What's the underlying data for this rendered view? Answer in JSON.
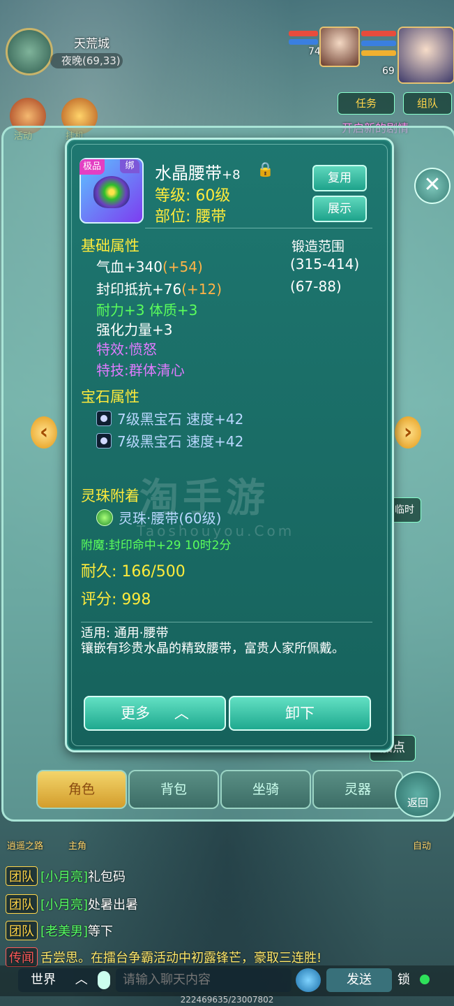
{
  "hud": {
    "city": "天荒城",
    "coord": "夜晚(69,33)",
    "pet_level": "74",
    "player_level": "69",
    "task_btn": "任务",
    "team_btn": "组队",
    "quest_hint": "开启新的剧情",
    "activity_label": "活动",
    "hangup_label": "挂机",
    "side_left_label": "逍遥之路",
    "side_char_label": "主角",
    "auto_label": "自动"
  },
  "tooltip": {
    "quality_badge": "极品",
    "bind_badge": "绑",
    "item_name": "水晶腰带",
    "item_plus": "+8",
    "level_line": "等级: 60级",
    "slot_line": "部位: 腰带",
    "btn_reuse": "复用",
    "btn_show": "展示",
    "base_title": "基础属性",
    "forge_title": "锻造范围",
    "attrs": [
      {
        "text": "气血+340",
        "bonus": "(+54)",
        "range": "(315-414)"
      },
      {
        "text": "封印抵抗+76",
        "bonus": "(+12)",
        "range": "(67-88)"
      }
    ],
    "green_attr": "耐力+3 体质+3",
    "strength_attr": "强化力量+3",
    "effect": "特效:愤怒",
    "skill": "特技:群体清心",
    "gem_title": "宝石属性",
    "gems": [
      "7级黑宝石 速度+42",
      "7级黑宝石 速度+42"
    ],
    "bead_title": "灵珠附着",
    "bead": "灵珠·腰带(60级)",
    "enchant": "附魔:封印命中+29  10时2分",
    "durability": "耐久: 166/500",
    "score": "评分: 998",
    "desc_applicable": "适用: 通用·腰带",
    "desc_text": "镶嵌有珍贵水晶的精致腰带，富贵人家所佩戴。",
    "btn_more": "更多",
    "btn_unequip": "卸下"
  },
  "watermark": {
    "main": "淘手游",
    "sub": "Taoshouyou.Com"
  },
  "panel": {
    "tabs": [
      "角色",
      "背包",
      "坐骑",
      "灵器"
    ],
    "return_label": "返回",
    "add_point": "加点",
    "temp": "临时"
  },
  "chat": {
    "lines": [
      {
        "tag": "团队",
        "name": "[小月亮]",
        "text": "礼包码"
      },
      {
        "tag": "团队",
        "name": "[小月亮]",
        "text": "处暑出暑"
      },
      {
        "tag": "团队",
        "name": "[老美男]",
        "text": "等下"
      }
    ],
    "broadcast": {
      "tag": "传闻",
      "text": "舌尝思。在擂台争霸活动中初露锋芒，豪取三连胜!"
    },
    "channel": "世界",
    "placeholder": "请输入聊天内容",
    "send": "发送",
    "lock": "锁",
    "footer": "222469635/23007802"
  }
}
